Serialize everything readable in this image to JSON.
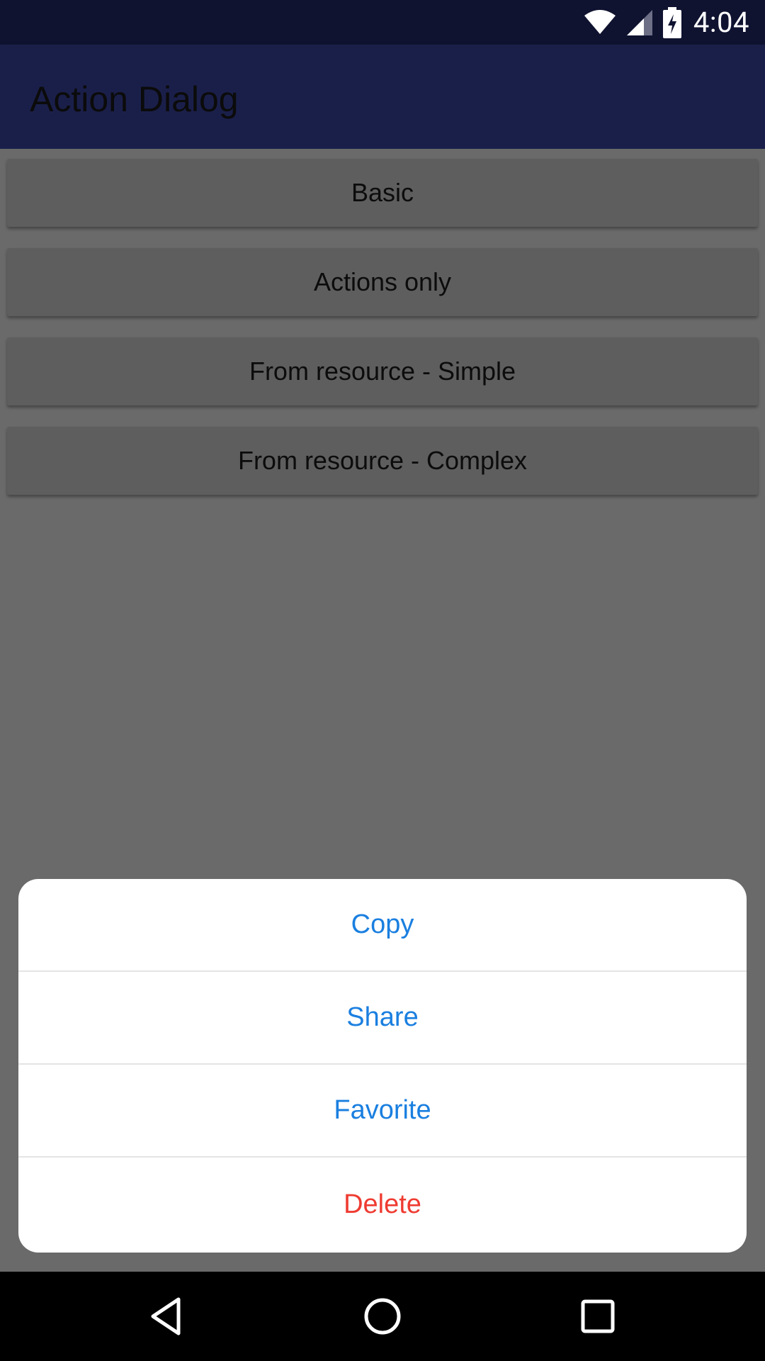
{
  "status_bar": {
    "time": "4:04",
    "icons": [
      "wifi-icon",
      "signal-icon",
      "battery-charging-icon"
    ]
  },
  "app_bar": {
    "title": "Action Dialog"
  },
  "main": {
    "buttons": [
      {
        "label": "Basic"
      },
      {
        "label": "Actions only"
      },
      {
        "label": "From resource - Simple"
      },
      {
        "label": "From resource - Complex"
      }
    ]
  },
  "dialog": {
    "actions": [
      {
        "label": "Copy",
        "style": "default"
      },
      {
        "label": "Share",
        "style": "default"
      },
      {
        "label": "Favorite",
        "style": "default"
      },
      {
        "label": "Delete",
        "style": "destructive"
      }
    ],
    "colors": {
      "action": "#1a7fe0",
      "destructive": "#ef3b31"
    }
  },
  "nav_bar": {
    "icons": [
      "back-icon",
      "home-icon",
      "recents-icon"
    ]
  }
}
